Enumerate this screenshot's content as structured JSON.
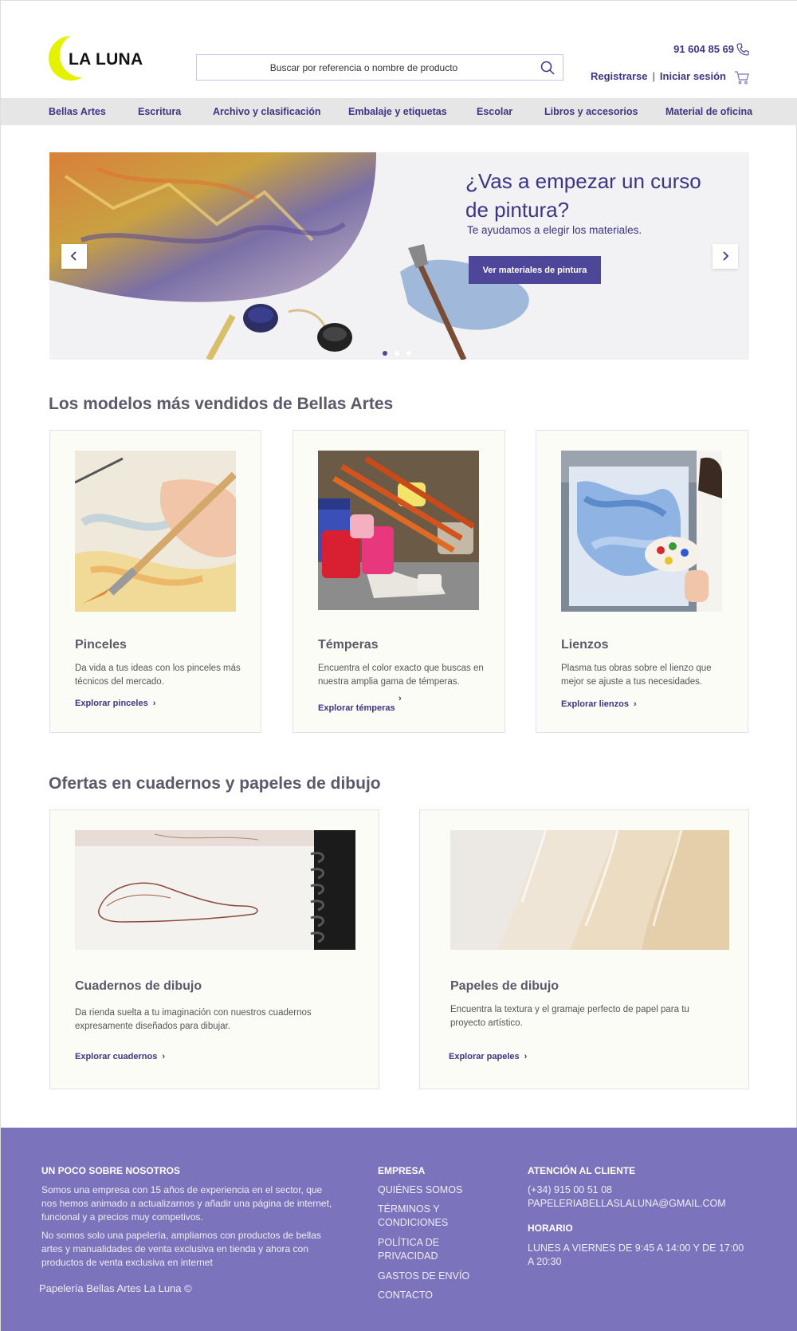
{
  "header": {
    "logo_text": "LA LUNA",
    "search_placeholder": "Buscar por referencia o nombre de producto",
    "phone": "91 604 85 69",
    "register": "Registrarse",
    "separator": "|",
    "login": "Iniciar sesión"
  },
  "nav": {
    "items": [
      "Bellas Artes",
      "Escritura",
      "Archivo y clasificación",
      "Embalaje y etiquetas",
      "Escolar",
      "Libros y accesorios",
      "Material de oficina"
    ]
  },
  "hero": {
    "title": "¿Vas a empezar un curso de pintura?",
    "subtitle": "Te ayudamos a elegir los materiales.",
    "button": "Ver materiales de pintura",
    "slides": 3,
    "active_slide": 1
  },
  "bestsellers": {
    "title": "Los modelos más vendidos de Bellas Artes",
    "cards": [
      {
        "title": "Pinceles",
        "desc": "Da vida a tus ideas con los pinceles más técnicos del mercado.",
        "link": "Explorar pinceles"
      },
      {
        "title": "Témperas",
        "desc": "Encuentra el color exacto que buscas en nuestra amplia gama de témperas.",
        "link": "Explorar témperas"
      },
      {
        "title": "Lienzos",
        "desc": "Plasma tus obras sobre el lienzo que mejor se ajuste a tus necesidades.",
        "link": "Explorar lienzos"
      }
    ]
  },
  "offers": {
    "title": "Ofertas en cuadernos y papeles de dibujo",
    "cards": [
      {
        "title": "Cuadernos de dibujo",
        "desc": "Da rienda suelta a tu imaginación con nuestros cuadernos expresamente diseñados para dibujar.",
        "link": "Explorar cuadernos"
      },
      {
        "title": "Papeles de dibujo",
        "desc": "Encuentra la textura y el gramaje perfecto de papel para tu proyecto artístico.",
        "link": "Explorar papeles"
      }
    ]
  },
  "footer": {
    "about_title": "UN POCO SOBRE NOSOTROS",
    "about_p1": "Somos una empresa con 15 años de experiencia en el sector, que nos hemos animado a actualizarnos y añadir una página de internet, funcional y a precios muy competivos.",
    "about_p2": "No somos solo una papelería, ampliamos con productos de bellas artes y manualidades de venta exclusiva en tienda y ahora con productos de venta exclusiva en internet",
    "copyright": "Papelería Bellas Artes La Luna  ©",
    "company_title": "EMPRESA",
    "company_links": [
      "QUIÉNES SOMOS",
      "TÉRMINOS Y CONDICIONES",
      "POLÍTICA DE PRIVACIDAD",
      "GASTOS DE ENVÍO",
      "CONTACTO"
    ],
    "service_title": "ATENCIÓN AL CLIENTE",
    "service_phone": "(+34) 915 00 51 08",
    "service_email": "PAPELERIABELLASLALUNA@GMAIL.COM",
    "hours_title": "HORARIO",
    "hours_text": "LUNES A VIERNES DE 9:45 A 14:00 Y DE 17:00 A 20:30"
  },
  "colors": {
    "brand": "#3b3585",
    "button": "#4e4799",
    "logo_moon": "#e4f200",
    "footer": "#7b73bb",
    "nav_bg": "#e6e6e6",
    "card_bg": "#fcfcf6"
  },
  "icons": [
    "search-icon",
    "phone-icon",
    "cart-icon",
    "chevron-left-icon",
    "chevron-right-icon"
  ]
}
